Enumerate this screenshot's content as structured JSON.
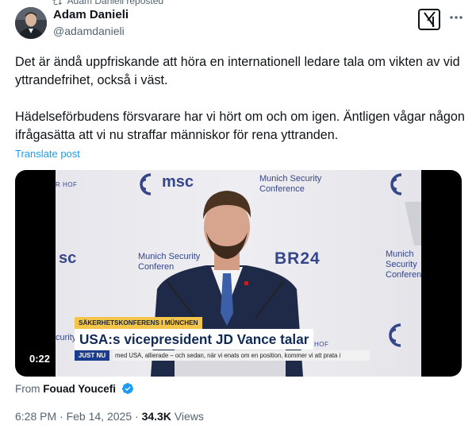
{
  "repost": {
    "label": "Adam Danieli reposted"
  },
  "author": {
    "name": "Adam Danieli",
    "handle": "@adamdanieli"
  },
  "icons": {
    "grok": "grok-icon",
    "more": "more-horizontal-icon",
    "verified": "verified-badge-icon",
    "repost": "repost-icon"
  },
  "tweet": {
    "paragraphs": [
      "Det är ändå uppfriskande att höra en internationell ledare tala om vikten av vid yttrandefrihet, också i väst.",
      "Hädelseförbudens försvarare har vi hört om och om igen. Äntligen vågar någon ifrågasätta att vi nu straffar människor för rena yttranden."
    ],
    "translate_label": "Translate post"
  },
  "video": {
    "duration": "0:22",
    "scene": {
      "logo_msc": "msc",
      "conference_line1": "Munich Security",
      "conference_line2": "Conference",
      "conference_line2_cut": "Conferen",
      "left_msc": "sc",
      "left_curity": "curity",
      "br24": "BR24",
      "edge_hof": "R HOF",
      "edge_hof2": "HOF"
    },
    "lower_third": {
      "kicker": "SÄKERHETSKONFERENS I MÜNCHEN",
      "headline": "USA:s vicepresident JD Vance talar",
      "ticker_tag": "JUST NU",
      "ticker_text": "med USA, allierade – och sedan, när vi enats om en position, kommer vi att prata i"
    }
  },
  "source": {
    "prefix": "From",
    "name": "Fouad Youcefi"
  },
  "meta": {
    "time": "6:28 PM",
    "sep": "·",
    "date": "Feb 14, 2025",
    "views_count": "34.3K",
    "views_label": "Views"
  },
  "colors": {
    "link": "#1d9bf0",
    "secondary": "#536471",
    "text": "#0f1419",
    "msc_blue": "#35468a",
    "kicker_yellow": "#f3c64a"
  }
}
